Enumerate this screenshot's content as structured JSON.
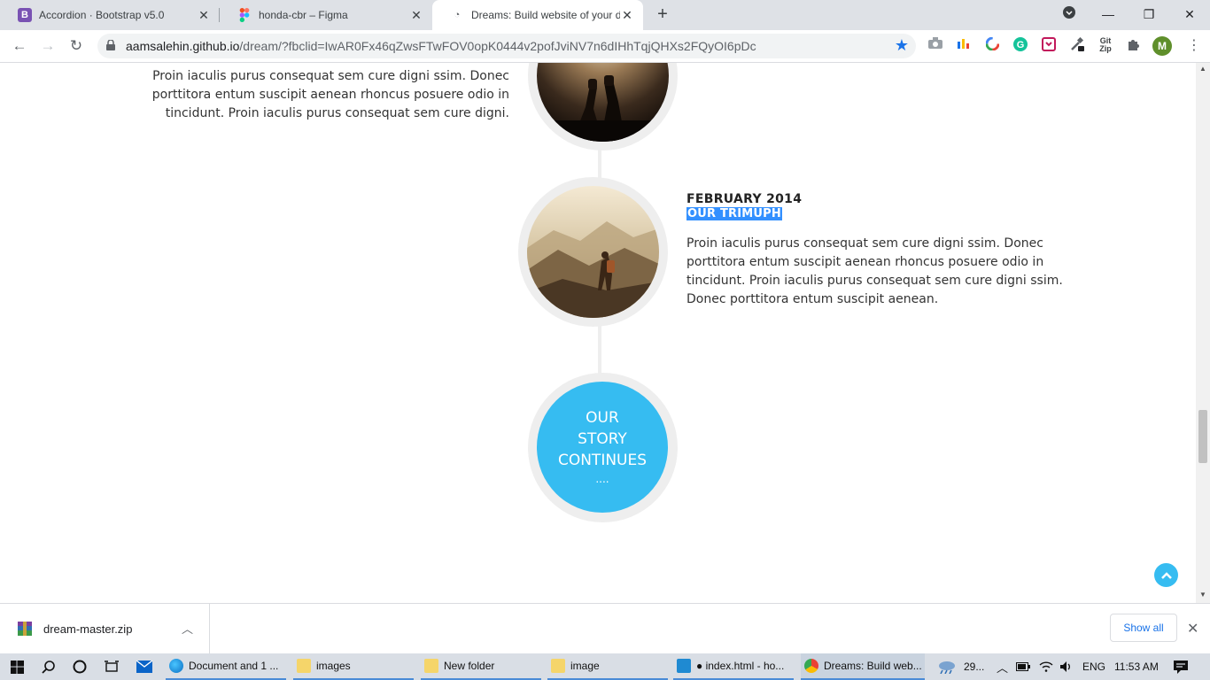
{
  "browser": {
    "tabs": [
      {
        "title": "Accordion · Bootstrap v5.0",
        "icon": "bootstrap-icon",
        "color": "#7952b3"
      },
      {
        "title": "honda-cbr – Figma",
        "icon": "figma-icon",
        "color": "#f24e1e"
      },
      {
        "title": "Dreams: Build website of your dr",
        "icon": "loading-icon",
        "color": "#5f6368"
      }
    ],
    "url_host": "aamsalehin.github.io",
    "url_path": "/dream/?fbclid=IwAR0Fx46qZwsFTwFOV0opK0444v2pofJviNV7n6dIHhTqjQHXs2FQyOI6pDc",
    "avatar_letter": "M"
  },
  "page": {
    "left_text": "Proin iaculis purus consequat sem cure digni ssim. Donec porttitora entum suscipit aenean rhoncus posuere odio in tincidunt. Proin iaculis purus consequat sem cure digni.",
    "entry_date": "FEBRUARY 2014",
    "entry_heading": "OUR TRIMUPH",
    "entry_text": "Proin iaculis purus consequat sem cure digni ssim. Donec porttitora entum suscipit aenean rhoncus posuere odio in tincidunt. Proin iaculis purus consequat sem cure digni ssim. Donec porttitora entum suscipit aenean.",
    "continues_line1": "OUR",
    "continues_line2": "STORY",
    "continues_line3": "CONTINUES",
    "continues_dots": "....",
    "accent_color": "#36bcf1"
  },
  "downloads": {
    "file_name": "dream-master.zip",
    "show_all_label": "Show all"
  },
  "taskbar": {
    "apps": [
      {
        "label": "Document and 1 ..."
      },
      {
        "label": "images"
      },
      {
        "label": "New folder"
      },
      {
        "label": "image"
      },
      {
        "label": "● index.html - ho..."
      },
      {
        "label": "Dreams: Build web..."
      }
    ],
    "weather": "29...",
    "language": "ENG",
    "time": "11:53 AM"
  }
}
